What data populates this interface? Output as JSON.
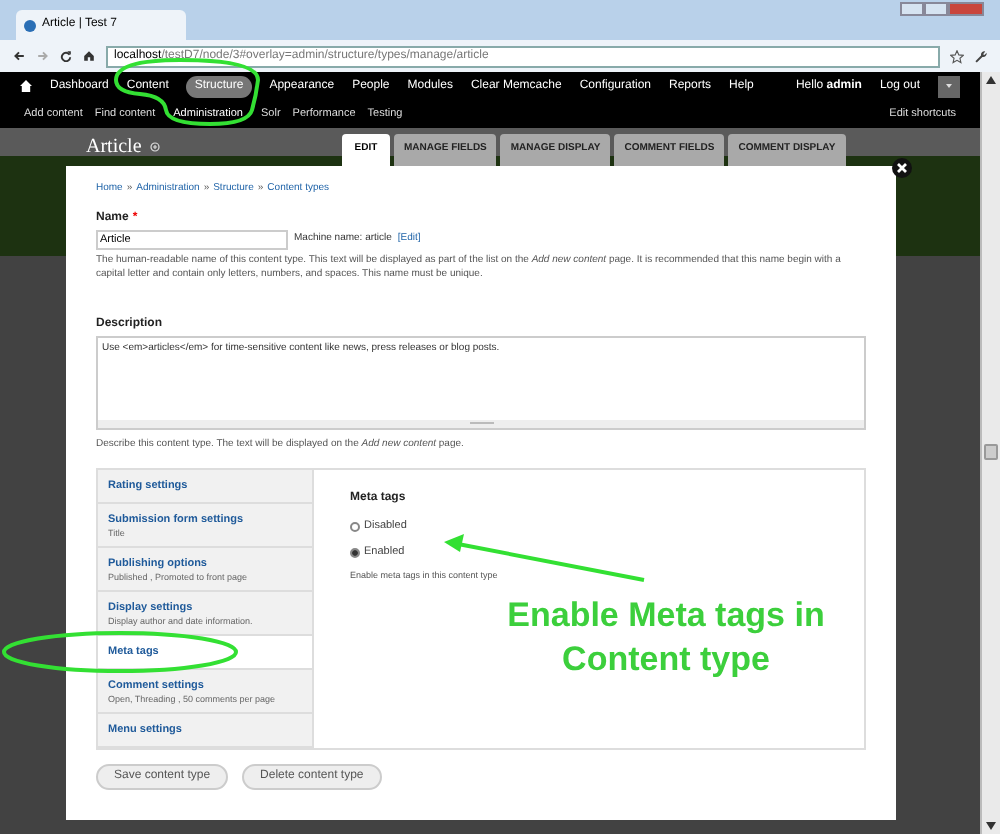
{
  "browser": {
    "tab_title": "Article | Test 7",
    "url_host": "localhost",
    "url_path": "/testD7/node/3#overlay=admin/structure/types/manage/article"
  },
  "toolbar": {
    "items": [
      {
        "label": "Dashboard",
        "selected": false
      },
      {
        "label": "Content",
        "selected": false
      },
      {
        "label": "Structure",
        "selected": true
      },
      {
        "label": "Appearance",
        "selected": false
      },
      {
        "label": "People",
        "selected": false
      },
      {
        "label": "Modules",
        "selected": false
      },
      {
        "label": "Clear Memcache",
        "selected": false
      },
      {
        "label": "Configuration",
        "selected": false
      },
      {
        "label": "Reports",
        "selected": false
      },
      {
        "label": "Help",
        "selected": false
      }
    ],
    "greeting": "Hello **admin**",
    "logout": "Log out"
  },
  "shortcuts": {
    "items": [
      {
        "label": "Add content",
        "selected": false
      },
      {
        "label": "Find content",
        "selected": false
      },
      {
        "label": "Administration",
        "selected": true
      },
      {
        "label": "Solr",
        "selected": false
      },
      {
        "label": "Performance",
        "selected": false
      },
      {
        "label": "Testing",
        "selected": false
      }
    ],
    "edit": "Edit shortcuts"
  },
  "overlay": {
    "title": "Article",
    "tabs": [
      {
        "label": "EDIT",
        "selected": true
      },
      {
        "label": "MANAGE FIELDS",
        "selected": false
      },
      {
        "label": "MANAGE DISPLAY",
        "selected": false
      },
      {
        "label": "COMMENT FIELDS",
        "selected": false
      },
      {
        "label": "COMMENT DISPLAY",
        "selected": false
      }
    ]
  },
  "breadcrumb": {
    "items": [
      "Home",
      "Administration",
      "Structure",
      "Content types"
    ],
    "separator": "»"
  },
  "name": {
    "label": "Name",
    "required": "*",
    "value": "Article",
    "machine_name": "Machine name: article",
    "edit_link": "[Edit]",
    "help": "The human-readable name of this content type. This text will be displayed as part of the list on the *Add new content* page. It is recommended that this name begin with a capital letter and contain only letters, numbers, and spaces. This name must be unique."
  },
  "description": {
    "label": "Description",
    "value": "Use <em>articles</em> for time-sensitive content like news, press releases or blog posts.",
    "help": "Describe this content type. The text will be displayed on the *Add new content* page."
  },
  "vertical_tabs": [
    {
      "title": "Rating settings",
      "selected": false
    },
    {
      "title": "Submission form settings",
      "summary": "Title",
      "selected": false
    },
    {
      "title": "Publishing options",
      "summary": "Published , Promoted to front page",
      "selected": false
    },
    {
      "title": "Display settings",
      "summary": "Display author and date information.",
      "selected": false
    },
    {
      "title": "Meta tags",
      "selected": true
    },
    {
      "title": "Comment settings",
      "summary": "Open, Threading , 50 comments per page",
      "selected": false
    },
    {
      "title": "Menu settings",
      "selected": false
    }
  ],
  "pane": {
    "title": "Meta tags",
    "options": [
      {
        "label": "Disabled",
        "selected": false
      },
      {
        "label": "Enabled",
        "selected": true
      }
    ],
    "help": "Enable meta tags in this content type"
  },
  "buttons": [
    "Save content type",
    "Delete content type"
  ],
  "annotation": {
    "text": "Enable Meta tags in Content type"
  }
}
